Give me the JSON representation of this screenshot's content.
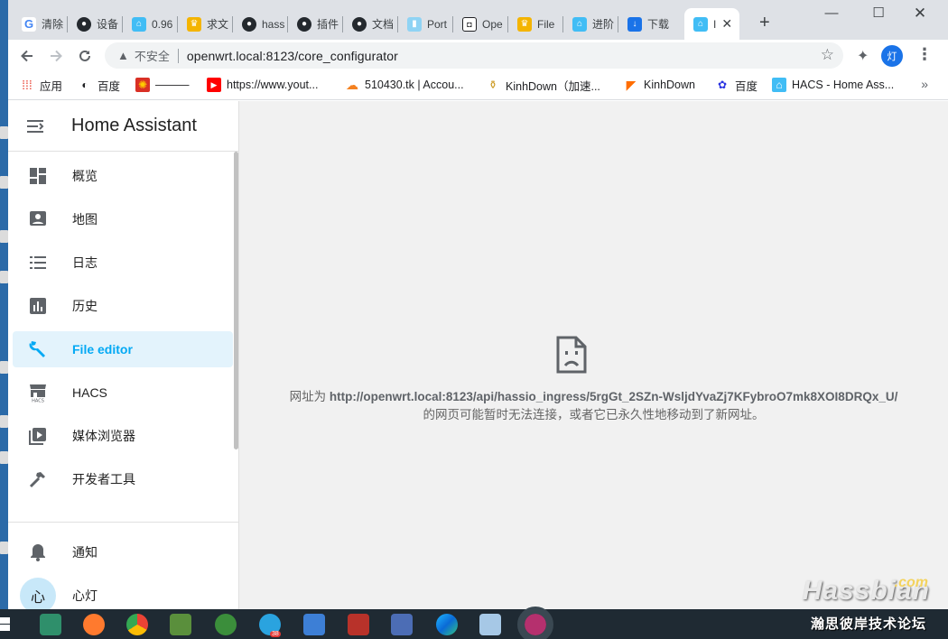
{
  "tabs": [
    {
      "title": "清除",
      "icon": "google-icon"
    },
    {
      "title": "设备",
      "icon": "github-icon"
    },
    {
      "title": "0.96",
      "icon": "home-assistant-icon"
    },
    {
      "title": "求文",
      "icon": "trophy-icon"
    },
    {
      "title": "hass",
      "icon": "github-icon"
    },
    {
      "title": "插件",
      "icon": "github-icon"
    },
    {
      "title": "文档",
      "icon": "github-icon"
    },
    {
      "title": "Port",
      "icon": "bottle-icon"
    },
    {
      "title": "Ope",
      "icon": "openwrt-icon"
    },
    {
      "title": "File",
      "icon": "trophy-icon"
    },
    {
      "title": "进阶",
      "icon": "home-assistant-icon"
    },
    {
      "title": "下载",
      "icon": "download-icon"
    },
    {
      "title": "I",
      "icon": "home-assistant-icon",
      "active": true
    }
  ],
  "address": {
    "security_label": "不安全",
    "url": "openwrt.local:8123/core_configurator"
  },
  "profile_initial": "灯",
  "bookmarks": [
    {
      "label": "应用",
      "icon": "apps-grid-icon"
    },
    {
      "label": "百度",
      "icon": "globe-icon"
    },
    {
      "label": "———",
      "icon": "fire-icon"
    },
    {
      "label": "https://www.yout...",
      "icon": "youtube-icon"
    },
    {
      "label": "510430.tk | Accou...",
      "icon": "cloudflare-icon"
    },
    {
      "label": "KinhDown（加速...",
      "icon": "kinhdown-icon"
    },
    {
      "label": "KinhDown",
      "icon": "flag-icon"
    },
    {
      "label": "百度",
      "icon": "baidu-icon"
    },
    {
      "label": "HACS - Home Ass...",
      "icon": "home-assistant-icon"
    }
  ],
  "sidebar": {
    "title": "Home Assistant",
    "items": [
      {
        "label": "概览",
        "icon": "dashboard-icon"
      },
      {
        "label": "地图",
        "icon": "map-icon"
      },
      {
        "label": "日志",
        "icon": "list-icon"
      },
      {
        "label": "历史",
        "icon": "chart-icon"
      },
      {
        "label": "File editor",
        "icon": "wrench-icon",
        "selected": true
      },
      {
        "label": "HACS",
        "icon": "hacs-icon"
      },
      {
        "label": "媒体浏览器",
        "icon": "media-icon"
      },
      {
        "label": "开发者工具",
        "icon": "hammer-icon"
      }
    ],
    "bottom": [
      {
        "label": "通知",
        "icon": "bell-icon"
      },
      {
        "label": "心灯",
        "avatar": "心"
      }
    ]
  },
  "error": {
    "prefix": "网址为 ",
    "url": "http://openwrt.local:8123/api/hassio_ingress/5rgGt_2SZn-WsljdYvaZj7KFybroO7mk8XOI8DRQx_U/",
    "suffix": "的网页可能暂时无法连接，或者它已永久性地移动到了新网址。"
  },
  "watermark": {
    "brand": "Hassbian",
    "com": ".com",
    "tagline": "瀚思彼岸技术论坛"
  },
  "taskbar_badge": "38"
}
